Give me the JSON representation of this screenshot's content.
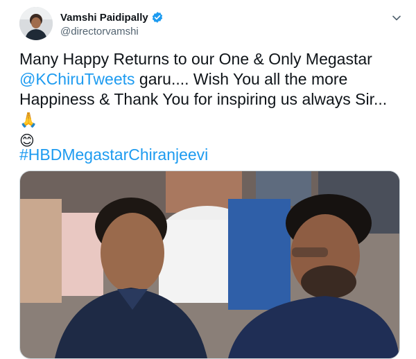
{
  "tweet": {
    "author": {
      "display_name": "Vamshi Paidipally",
      "handle": "@directorvamshi",
      "verified": true
    },
    "text": {
      "line1": "Many Happy Returns to our One & Only Megastar",
      "mention": "@KChiruTweets",
      "line2_rest": " garu.... Wish You all the more",
      "line3": "Happiness & Thank You for inspiring us always Sir...",
      "emoji_pray": "🙏",
      "emoji_smile": "😊"
    },
    "hashtag": "#HBDMegastarChiranjeevi",
    "media": {
      "type": "photo"
    }
  },
  "colors": {
    "link": "#1d9bf0",
    "text": "#0f1419",
    "secondary": "#536471",
    "verified": "#1d9bf0"
  },
  "icons": [
    "verified-badge-icon",
    "more-options-icon"
  ]
}
